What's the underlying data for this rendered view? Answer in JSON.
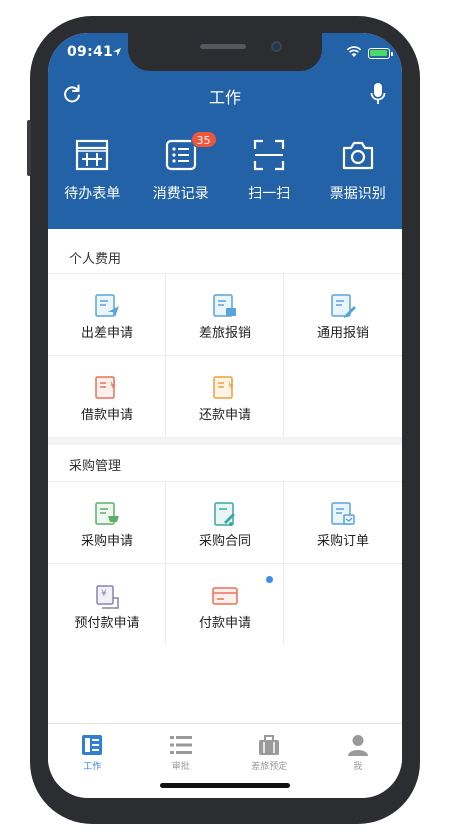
{
  "status": {
    "time": "09:41"
  },
  "navbar": {
    "title": "工作"
  },
  "quick_actions": [
    {
      "label": "待办表单",
      "icon": "todo-form-icon"
    },
    {
      "label": "消费记录",
      "icon": "consumption-list-icon",
      "badge": "35"
    },
    {
      "label": "扫一扫",
      "icon": "scan-icon"
    },
    {
      "label": "票据识别",
      "icon": "camera-icon"
    }
  ],
  "personal": {
    "title": "个人费用",
    "items": [
      {
        "label": "出差申请",
        "icon": "travel-application-icon",
        "color": "#5aa3d8"
      },
      {
        "label": "差旅报销",
        "icon": "travel-reimbursement-icon",
        "color": "#5aa3d8"
      },
      {
        "label": "通用报销",
        "icon": "general-reimbursement-icon",
        "color": "#5aa3d8"
      },
      {
        "label": "借款申请",
        "icon": "loan-application-icon",
        "color": "#e8705a"
      },
      {
        "label": "还款申请",
        "icon": "repayment-application-icon",
        "color": "#e9a23b"
      }
    ]
  },
  "procurement": {
    "title": "采购管理",
    "items": [
      {
        "label": "采购申请",
        "icon": "purchase-application-icon",
        "color": "#5dae6a"
      },
      {
        "label": "采购合同",
        "icon": "purchase-contract-icon",
        "color": "#3ba9a0"
      },
      {
        "label": "采购订单",
        "icon": "purchase-order-icon",
        "color": "#5aa3d8"
      },
      {
        "label": "预付款申请",
        "icon": "prepayment-application-icon",
        "color": "#8a82b0"
      },
      {
        "label": "付款申请",
        "icon": "payment-application-icon",
        "color": "#e8705a",
        "dot": true
      }
    ]
  },
  "tabs": [
    {
      "label": "工作",
      "icon": "work-icon",
      "active": true
    },
    {
      "label": "审批",
      "icon": "approval-list-icon"
    },
    {
      "label": "差旅预定",
      "icon": "luggage-icon"
    },
    {
      "label": "我",
      "icon": "person-icon"
    }
  ],
  "colors": {
    "primary": "#2462a7",
    "badge": "#f0563c",
    "tab_active": "#2f7fd2"
  }
}
